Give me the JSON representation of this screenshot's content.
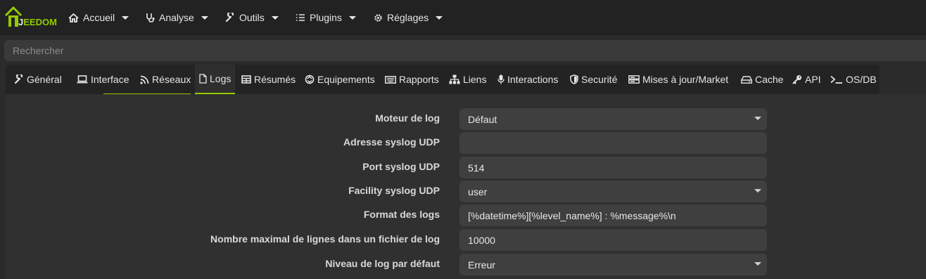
{
  "brand": {
    "logo_text": "EEDOM",
    "logo_letter": "J"
  },
  "nav": [
    {
      "label": "Accueil",
      "icon": "home-icon"
    },
    {
      "label": "Analyse",
      "icon": "stethoscope-icon"
    },
    {
      "label": "Outils",
      "icon": "wrench-icon"
    },
    {
      "label": "Plugins",
      "icon": "tasks-icon"
    },
    {
      "label": "Réglages",
      "icon": "gear-icon"
    }
  ],
  "search": {
    "placeholder": "Rechercher"
  },
  "tabs": [
    {
      "label": "Général",
      "icon": "wrench-icon"
    },
    {
      "label": "Interface",
      "icon": "laptop-icon"
    },
    {
      "label": "Réseaux",
      "icon": "rss-icon"
    },
    {
      "label": "Logs",
      "icon": "file-icon"
    },
    {
      "label": "Résumés",
      "icon": "table-icon"
    },
    {
      "label": "Equipements",
      "icon": "recycle-icon"
    },
    {
      "label": "Rapports",
      "icon": "keyboard-icon"
    },
    {
      "label": "Liens",
      "icon": "sitemap-icon"
    },
    {
      "label": "Interactions",
      "icon": "microphone-icon"
    },
    {
      "label": "Securité",
      "icon": "shield-icon"
    },
    {
      "label": "Mises à jour/Market",
      "icon": "server-icon"
    },
    {
      "label": "Cache",
      "icon": "hdd-icon"
    },
    {
      "label": "API",
      "icon": "key-icon"
    },
    {
      "label": "OS/DB",
      "icon": "terminal-icon"
    }
  ],
  "active_tab": "Logs",
  "form": [
    {
      "label": "Moteur de log",
      "value": "Défaut",
      "type": "select"
    },
    {
      "label": "Adresse syslog UDP",
      "value": "",
      "type": "text"
    },
    {
      "label": "Port syslog UDP",
      "value": "514",
      "type": "text"
    },
    {
      "label": "Facility syslog UDP",
      "value": "user",
      "type": "select"
    },
    {
      "label": "Format des logs",
      "value": "[%datetime%][%level_name%] : %message%\\n",
      "type": "text"
    },
    {
      "label": "Nombre maximal de lignes dans un fichier de log",
      "value": "10000",
      "type": "text"
    },
    {
      "label": "Niveau de log par défaut",
      "value": "Erreur",
      "type": "select"
    }
  ],
  "colors": {
    "accent": "#94ca02",
    "background": "#2b2b2b",
    "topbar": "#222222"
  }
}
